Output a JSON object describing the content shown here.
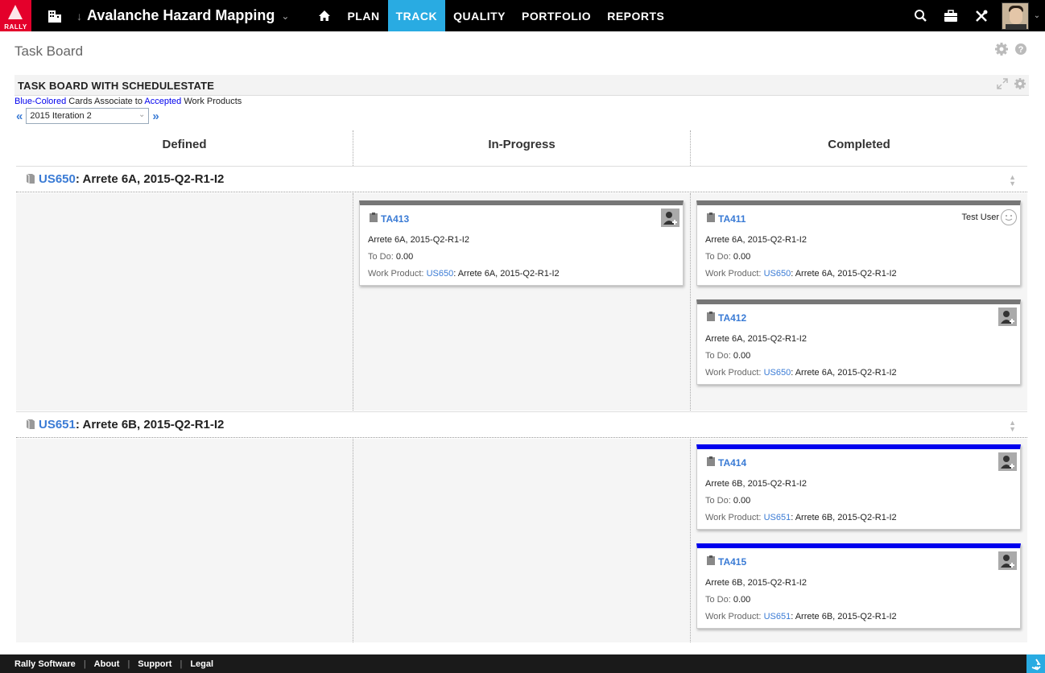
{
  "topbar": {
    "logo_text": "RALLY",
    "project_name": "Avalanche Hazard Mapping",
    "nav": [
      "PLAN",
      "TRACK",
      "QUALITY",
      "PORTFOLIO",
      "REPORTS"
    ],
    "active_nav": "TRACK",
    "accent": "#29abe2",
    "brand": "#e4002b"
  },
  "page": {
    "title": "Task Board"
  },
  "panel": {
    "title": "TASK BOARD WITH SCHEDULESTATE",
    "legend_part1": "Blue-Colored",
    "legend_part2": " Cards Associate to ",
    "legend_part3": "Accepted",
    "legend_part4": " Work Products",
    "prev": "«",
    "next": "»",
    "iteration": "2015 Iteration 2"
  },
  "columns": [
    "Defined",
    "In-Progress",
    "Completed"
  ],
  "rows": [
    {
      "id": "US650",
      "title": ": Arrete 6A, 2015-Q2-R1-I2"
    },
    {
      "id": "US651",
      "title": ": Arrete 6B, 2015-Q2-R1-I2"
    }
  ],
  "labels": {
    "todo": "To Do:",
    "work_product": "Work Product:"
  },
  "cards": {
    "ta413": {
      "id": "TA413",
      "name": "Arrete 6A, 2015-Q2-R1-I2",
      "todo": "0.00",
      "wp_id": "US650",
      "wp_name": ": Arrete 6A, 2015-Q2-R1-I2"
    },
    "ta411": {
      "id": "TA411",
      "name": "Arrete 6A, 2015-Q2-R1-I2",
      "todo": "0.00",
      "wp_id": "US650",
      "wp_name": ": Arrete 6A, 2015-Q2-R1-I2",
      "owner": "Test User"
    },
    "ta412": {
      "id": "TA412",
      "name": "Arrete 6A, 2015-Q2-R1-I2",
      "todo": "0.00",
      "wp_id": "US650",
      "wp_name": ": Arrete 6A, 2015-Q2-R1-I2"
    },
    "ta414": {
      "id": "TA414",
      "name": "Arrete 6B, 2015-Q2-R1-I2",
      "todo": "0.00",
      "wp_id": "US651",
      "wp_name": ": Arrete 6B, 2015-Q2-R1-I2"
    },
    "ta415": {
      "id": "TA415",
      "name": "Arrete 6B, 2015-Q2-R1-I2",
      "todo": "0.00",
      "wp_id": "US651",
      "wp_name": ": Arrete 6B, 2015-Q2-R1-I2"
    }
  },
  "footer": [
    "Rally Software",
    "About",
    "Support",
    "Legal"
  ]
}
